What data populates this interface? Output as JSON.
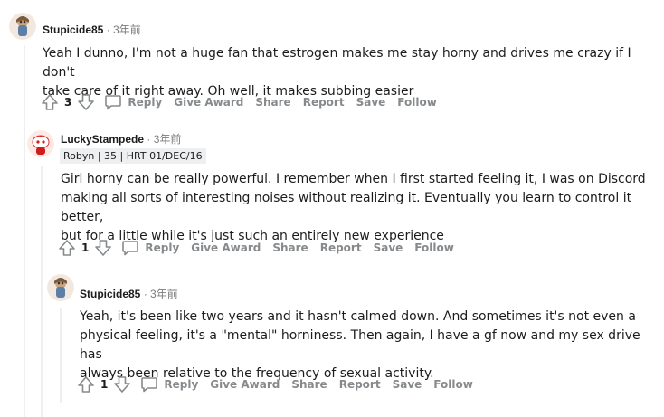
{
  "comments": [
    {
      "author": "Stupicide85",
      "time": "3年前",
      "flair": "",
      "lines": [
        "Yeah I dunno, I'm not a huge fan that estrogen makes me stay horny and drives me crazy if I don't",
        "take care of it right away. Oh well, it makes subbing easier"
      ],
      "votes": "3"
    },
    {
      "author": "LuckyStampede",
      "time": "3年前",
      "flair": "Robyn | 35 | HRT 01/DEC/16",
      "lines": [
        "Girl horny can be really powerful. I remember when I first started feeling it, I was on Discord",
        "making all sorts of interesting noises without realizing it. Eventually you learn to control it better,",
        "but for a little while it's just such an entirely new experience"
      ],
      "votes": "1"
    },
    {
      "author": "Stupicide85",
      "time": "3年前",
      "flair": "",
      "lines": [
        "Yeah, it's been like two years and it hasn't calmed down. And sometimes it's not even a",
        "physical feeling, it's a \"mental\" horniness. Then again, I have a gf now and my sex drive has",
        "always been relative to the frequency of sexual activity."
      ],
      "votes": "1"
    }
  ],
  "actions": {
    "reply": "Reply",
    "give_award": "Give Award",
    "share": "Share",
    "report": "Report",
    "save": "Save",
    "follow": "Follow"
  },
  "separator": "·",
  "icons": {
    "upvote": "upvote-arrow-icon",
    "downvote": "downvote-arrow-icon",
    "reply": "comment-bubble-icon",
    "avatar": "snoo-avatar"
  },
  "colors": {
    "text": "#1c1c1c",
    "meta": "#7c7c7c",
    "action": "#878a8c",
    "thread_line": "#edeff1",
    "flair_bg": "#edeff1"
  }
}
